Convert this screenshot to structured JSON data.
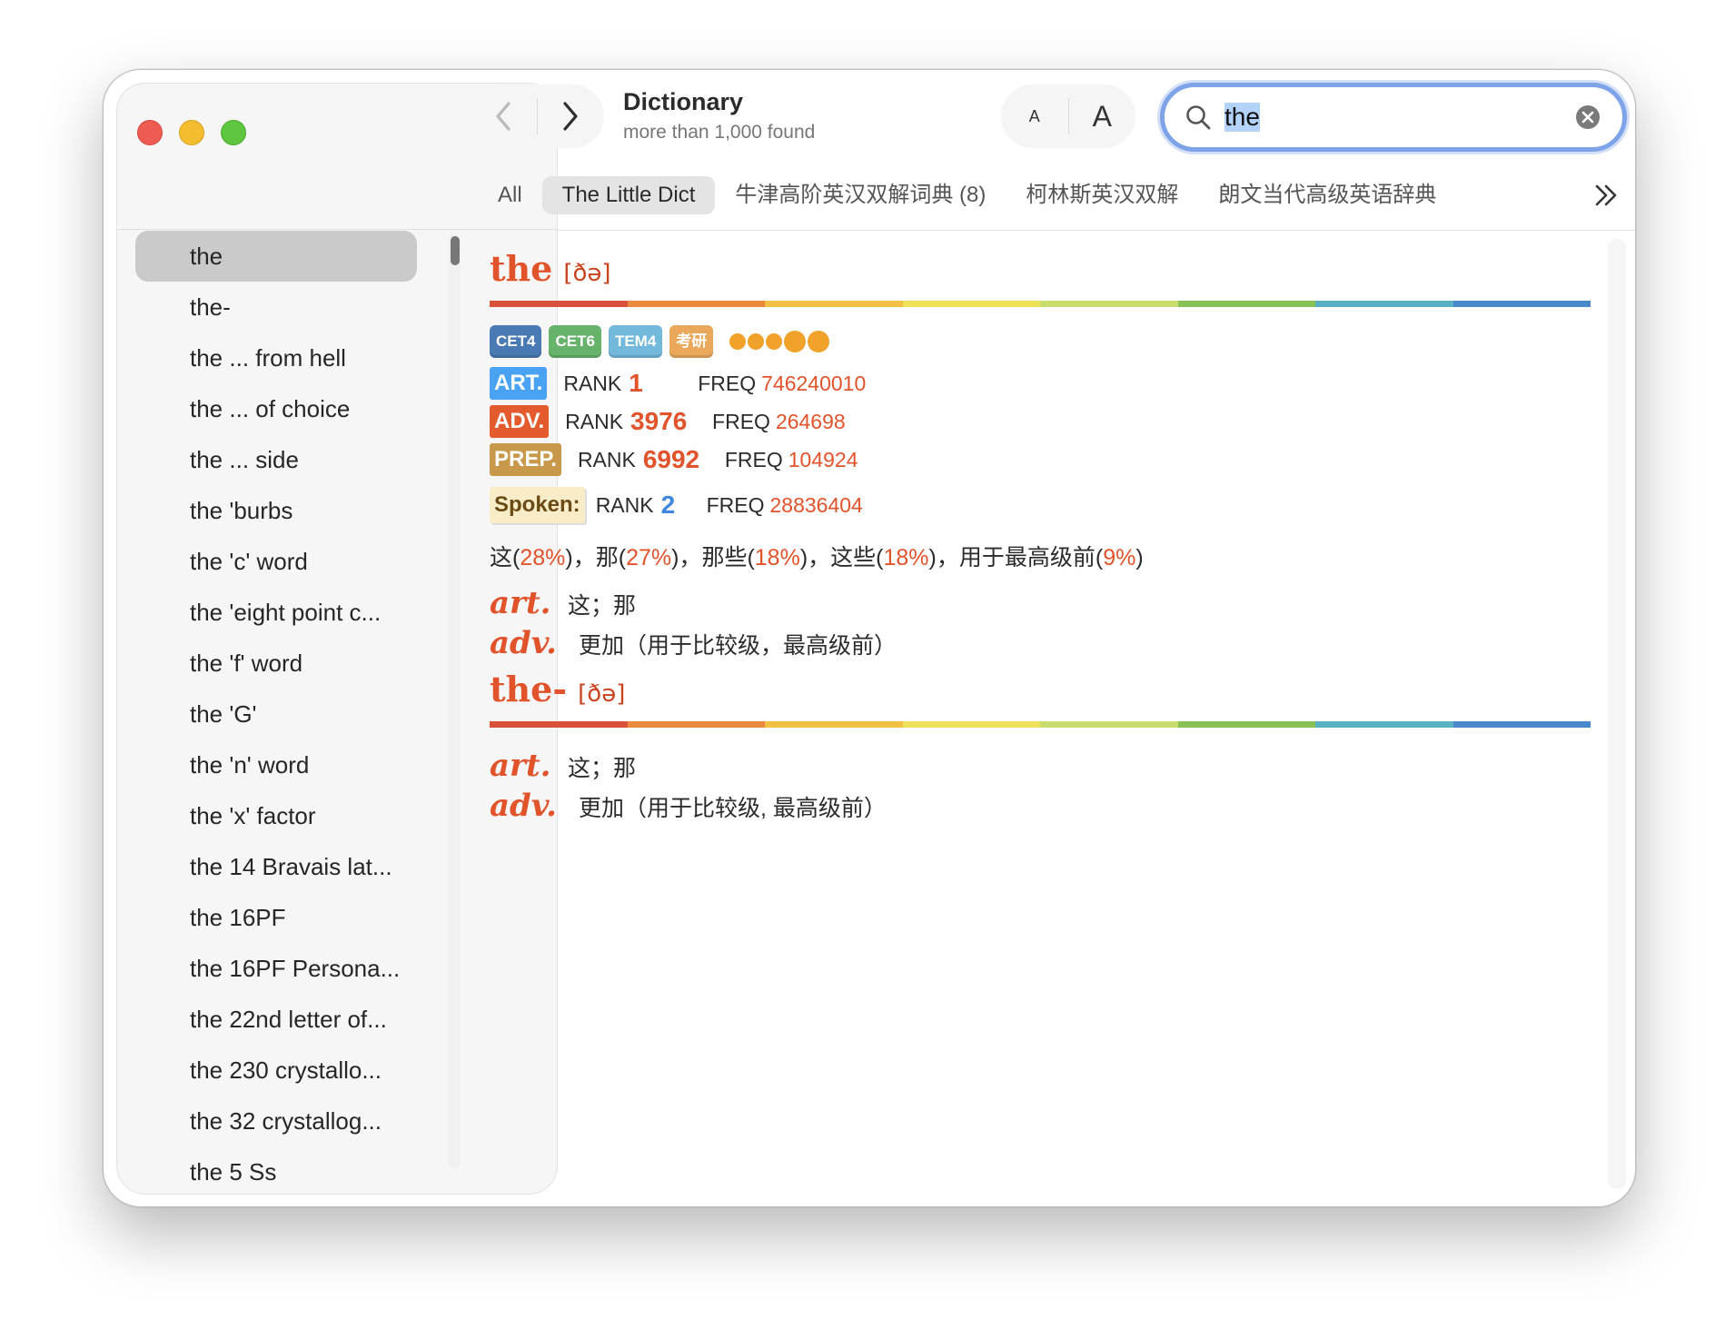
{
  "window": {
    "traffic_lights": [
      "close",
      "minimize",
      "zoom"
    ]
  },
  "toolbar": {
    "title": "Dictionary",
    "subtitle": "more than 1,000 found",
    "font_small_label": "A",
    "font_large_label": "A"
  },
  "search": {
    "value": "the",
    "placeholder": ""
  },
  "tabs": [
    {
      "label": "All",
      "active": false
    },
    {
      "label": "The Little Dict",
      "active": true
    },
    {
      "label": "牛津高阶英汉双解词典 (8)",
      "active": false
    },
    {
      "label": "柯林斯英汉双解",
      "active": false
    },
    {
      "label": "朗文当代高级英语辞典",
      "active": false
    }
  ],
  "word_list": [
    "the",
    "the-",
    "the ... from hell",
    "the ... of choice",
    "the ... side",
    "the 'burbs",
    "the 'c' word",
    "the 'eight point c...",
    "the 'f' word",
    "the 'G'",
    "the 'n' word",
    "the 'x' factor",
    "the 14 Bravais lat...",
    "the 16PF",
    "the 16PF Persona...",
    "the 22nd letter of...",
    "the 230 crystallo...",
    "the 32 crystallog...",
    "the 5 Ss"
  ],
  "selected_word_index": 0,
  "entries": [
    {
      "headword": "the",
      "phonetic": "[ðə]",
      "badges": [
        {
          "label": "CET4",
          "color": "#4a7ab3"
        },
        {
          "label": "CET6",
          "color": "#67b36b"
        },
        {
          "label": "TEM4",
          "color": "#72b9dc"
        },
        {
          "label": "考研",
          "color": "#e9a85a"
        }
      ],
      "stars": 5,
      "ranks": [
        {
          "pos": "ART.",
          "pos_color": "#4aa3f2",
          "rank_label": "RANK",
          "rank": "1",
          "freq_label": "FREQ",
          "freq": "746240010"
        },
        {
          "pos": "ADV.",
          "pos_color": "#e35a2d",
          "rank_label": "RANK",
          "rank": "3976",
          "freq_label": "FREQ",
          "freq": "264698"
        },
        {
          "pos": "PREP.",
          "pos_color": "#c8994a",
          "rank_label": "RANK",
          "rank": "6992",
          "freq_label": "FREQ",
          "freq": "104924"
        }
      ],
      "spoken": {
        "label": "Spoken:",
        "rank_label": "RANK",
        "rank": "2",
        "freq_label": "FREQ",
        "freq": "28836404"
      },
      "meanings_pct": [
        {
          "word": "这",
          "pct": "28%"
        },
        {
          "word": "那",
          "pct": "27%"
        },
        {
          "word": "那些",
          "pct": "18%"
        },
        {
          "word": "这些",
          "pct": "18%"
        },
        {
          "word": "用于最高级前",
          "pct": "9%"
        }
      ],
      "definitions": [
        {
          "pos": "art.",
          "text": "这；那"
        },
        {
          "pos": "adv.",
          "text": "更加（用于比较级，最高级前）"
        }
      ]
    },
    {
      "headword": "the-",
      "phonetic": "[ðə]",
      "definitions": [
        {
          "pos": "art.",
          "text": "这；那"
        },
        {
          "pos": "adv.",
          "text": "更加（用于比较级, 最高级前）"
        }
      ]
    }
  ],
  "colors": {
    "accent": "#e1532a",
    "search_focus": "#7ea3e8",
    "rainbow": [
      "#d9513a",
      "#ea8a3f",
      "#f2c143",
      "#efe25a",
      "#c8dd6d",
      "#86c255",
      "#5ab0c3",
      "#4a88cc"
    ]
  }
}
